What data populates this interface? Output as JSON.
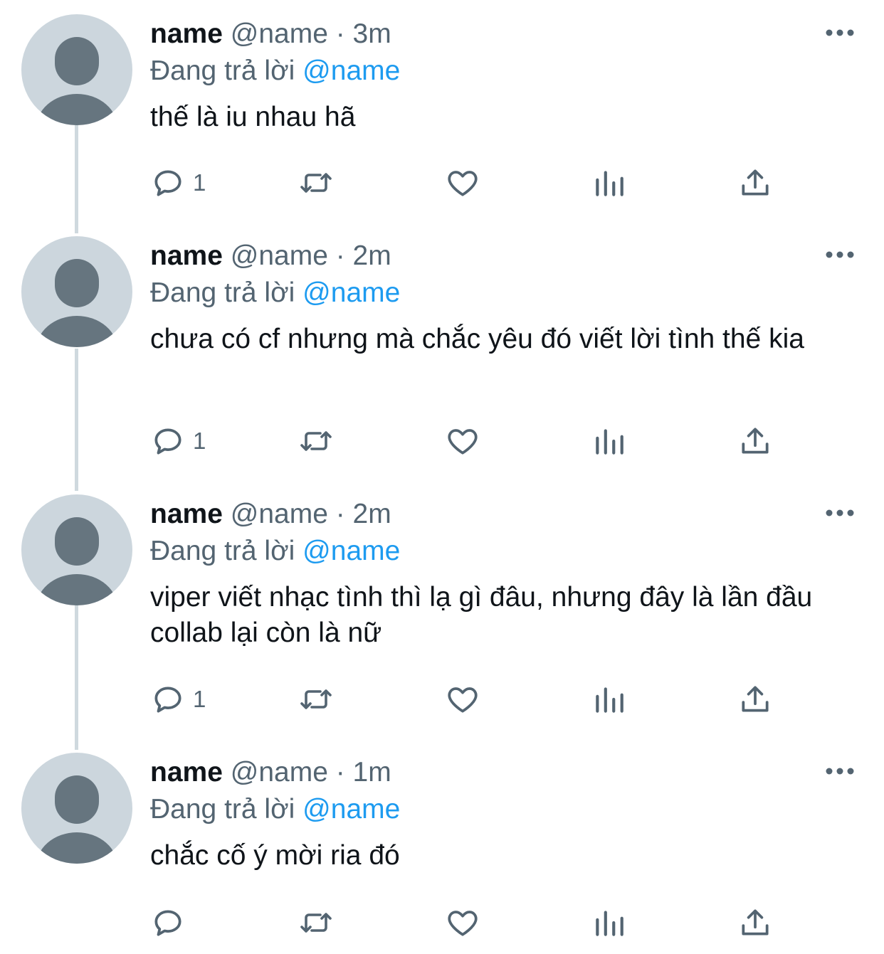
{
  "tweets": [
    {
      "name": "name",
      "handle_time": "@name · 3m",
      "reply_prefix": "Đang trả lời",
      "reply_mention": "@name",
      "text": "thế là iu nhau hã",
      "reply_count": "1"
    },
    {
      "name": "name",
      "handle_time": "@name · 2m",
      "reply_prefix": "Đang trả lời",
      "reply_mention": "@name",
      "text": "chưa có cf nhưng mà chắc yêu đó viết lời tình thế kia",
      "reply_count": "1"
    },
    {
      "name": "name",
      "handle_time": "@name · 2m",
      "reply_prefix": "Đang trả lời",
      "reply_mention": "@name",
      "text": "viper viết nhạc tình thì lạ gì đâu, nhưng đây là lần đầu collab lại còn là nữ",
      "reply_count": "1"
    },
    {
      "name": "name",
      "handle_time": "@name · 1m",
      "reply_prefix": "Đang trả lời",
      "reply_mention": "@name",
      "text": "chắc cố ý mời ria đó",
      "reply_count": ""
    }
  ],
  "icons": {
    "avatar": "default-avatar-icon",
    "more": "more-options-icon",
    "reply": "reply-bubble-icon",
    "retweet": "retweet-icon",
    "like": "heart-icon",
    "views": "views-chart-icon",
    "share": "share-upload-icon"
  },
  "colors": {
    "text": "#0f1419",
    "secondary": "#536471",
    "mention": "#1d9bf0",
    "avatar_bg": "#ccd6dd",
    "avatar_figure": "#66757f",
    "thread_line": "#cfd9de"
  }
}
